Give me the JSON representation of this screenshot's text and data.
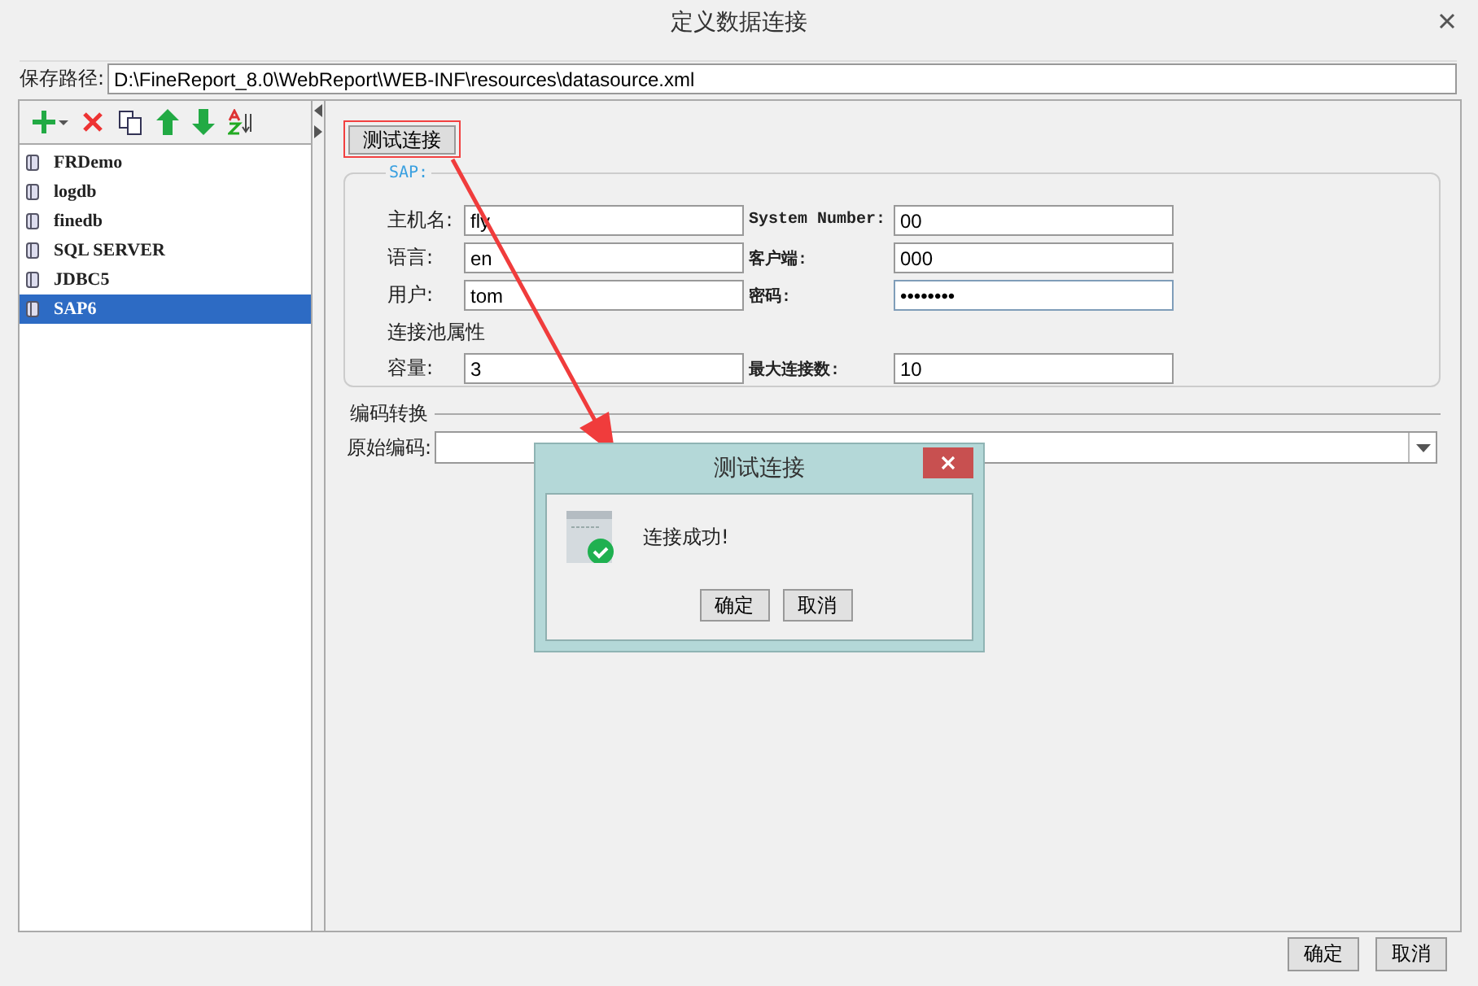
{
  "window": {
    "title": "定义数据连接"
  },
  "save_path": {
    "label": "保存路径:",
    "value": "D:\\FineReport_8.0\\WebReport\\WEB-INF\\resources\\datasource.xml"
  },
  "connections": [
    {
      "name": "FRDemo",
      "selected": false
    },
    {
      "name": "logdb",
      "selected": false
    },
    {
      "name": "finedb",
      "selected": false
    },
    {
      "name": "SQL SERVER",
      "selected": false
    },
    {
      "name": "JDBC5",
      "selected": false
    },
    {
      "name": "SAP6",
      "selected": true
    }
  ],
  "test_button": "测试连接",
  "sap": {
    "title": "SAP:",
    "rows": [
      [
        {
          "label": "主机名:",
          "value": "fly",
          "kind": "text"
        },
        {
          "label": "System Number:",
          "value": "00",
          "kind": "text"
        }
      ],
      [
        {
          "label": "语言:",
          "value": "en",
          "kind": "text"
        },
        {
          "label": "客户端:",
          "value": "000",
          "kind": "text"
        }
      ],
      [
        {
          "label": "用户:",
          "value": "tom",
          "kind": "text"
        },
        {
          "label": "密码:",
          "value": "••••••••",
          "kind": "password"
        }
      ]
    ],
    "pool_title": "连接池属性",
    "pool_rows": [
      [
        {
          "label": "容量:",
          "value": "3",
          "kind": "text"
        },
        {
          "label": "最大连接数:",
          "value": "10",
          "kind": "text"
        }
      ]
    ]
  },
  "encoding": {
    "title": "编码转换",
    "label": "原始编码:"
  },
  "dialog": {
    "title": "测试连接",
    "message": "连接成功!",
    "buttons": [
      "确定",
      "取消"
    ]
  },
  "buttons": [
    "确定",
    "取消"
  ]
}
